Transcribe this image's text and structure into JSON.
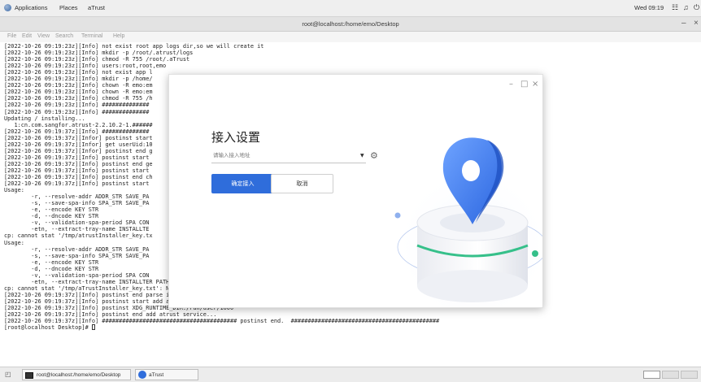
{
  "topbar": {
    "applications": "Applications",
    "places": "Places",
    "app_name": "aTrust",
    "clock": "Wed 09:19"
  },
  "terminal_window": {
    "title": "root@localhost:/home/emo/Desktop",
    "menu": [
      "File",
      "Edit",
      "View",
      "Search",
      "Terminal",
      "Help"
    ]
  },
  "terminal_lines": [
    "[2022-10-26 09:19:23z][Info] not exist root app logs dir,so we will create it",
    "[2022-10-26 09:19:23z][Info] mkdir -p /root/.atrust/logs",
    "[2022-10-26 09:19:23z][Info] chmod -R 755 /root/.aTrust",
    "[2022-10-26 09:19:23z][Info] users:root,root,emo",
    "[2022-10-26 09:19:23z][Info] not exist app l",
    "[2022-10-26 09:19:23z][Info] mkdir -p /home/",
    "[2022-10-26 09:19:23z][Info] chown -R emo:em",
    "[2022-10-26 09:19:23z][Info] chown -R emo:em",
    "[2022-10-26 09:19:23z][Info] chmod -R 755 /h",
    "[2022-10-26 09:19:23z][Info] ##############",
    "[2022-10-26 09:19:23z][Info] ##############",
    "Updating / installing...",
    "   1:cn.com.sangfor.atrust-2.2.10.2-1.######",
    "[2022-10-26 09:19:37z][Info] ##############",
    "[2022-10-26 09:19:37z][Infor] postinst start",
    "[2022-10-26 09:19:37z][Infor] get userUid:10",
    "[2022-10-26 09:19:37z][Infor] postinst end g",
    "[2022-10-26 09:19:37z][Info] postinst start",
    "[2022-10-26 09:19:37z][Info] postinst end ge",
    "[2022-10-26 09:19:37z][Info] postinst start",
    "[2022-10-26 09:19:37z][Info] postinst end ch",
    "[2022-10-26 09:19:37z][Info] postinst start",
    "Usage:",
    "        -r, --resolve-addr ADDR_STR SAVE_PA",
    "        -s, --save-spa-info SPA_STR SAVE_PA",
    "        -e, --encode KEY STR",
    "        -d, --dncode KEY STR",
    "        -v, --validation-spa-period SPA CON",
    "        -etn, --extract-tray-name INSTALLTE",
    "cp: cannot stat '/tmp/atrustInstaller_key.tx",
    "Usage:",
    "        -r, --resolve-addr ADDR_STR SAVE_PA",
    "        -s, --save-spa-info SPA_STR SAVE_PA",
    "        -e, --encode KEY STR",
    "        -d, --dncode KEY STR",
    "        -v, --validation-spa-period SPA CON",
    "        -etn, --extract-tray-name INSTALLTER PATH TRAY NAME PATH",
    "cp: cannot stat '/tmp/aTrustInstaller_key.txt': No such file or directory",
    "[2022-10-26 09:19:37z][Info] postinst end parse info...",
    "[2022-10-26 09:19:37z][Info] postinst start add atrust service...",
    "[2022-10-26 09:19:37z][Info] postinst XDG_RUNTIME_DIR:/run/user/1000",
    "[2022-10-26 09:19:37z][Info] postinst end add atrust service...",
    "[2022-10-26 09:19:37z][Info] ######################################## postinst end.  ############################################",
    "[root@localhost Desktop]# "
  ],
  "dialog": {
    "title": "接入设置",
    "address_placeholder": "请输入接入地址",
    "confirm_label": "确定接入",
    "cancel_label": "取消"
  },
  "taskbar": {
    "terminal_label": "root@localhost:/home/emo/Desktop",
    "atrust_label": "aTrust"
  },
  "colors": {
    "accent": "#2f6ddb",
    "illustration_blue": "#3f7ff0",
    "illustration_green": "#36c08a"
  }
}
